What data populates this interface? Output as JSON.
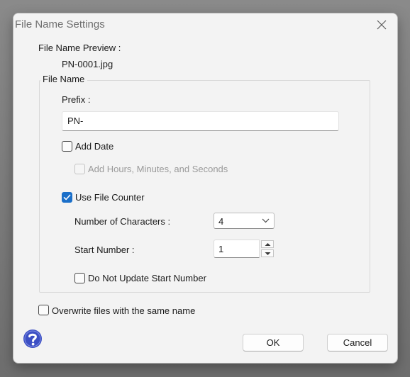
{
  "window": {
    "title": "File Name Settings"
  },
  "preview": {
    "label": "File Name Preview :",
    "value": "PN-0001.jpg"
  },
  "file_name_group": {
    "legend": "File Name",
    "prefix_label": "Prefix :",
    "prefix_value": "PN-",
    "add_date": {
      "label": "Add Date",
      "checked": false
    },
    "add_time": {
      "label": "Add Hours, Minutes, and Seconds",
      "checked": false,
      "enabled": false
    },
    "use_counter": {
      "label": "Use File Counter",
      "checked": true
    },
    "num_chars": {
      "label": "Number of Characters :",
      "value": "4"
    },
    "start_number": {
      "label": "Start Number :",
      "value": "1"
    },
    "do_not_update": {
      "label": "Do Not Update Start Number",
      "checked": false
    }
  },
  "overwrite": {
    "label": "Overwrite files with the same name",
    "checked": false
  },
  "buttons": {
    "ok": "OK",
    "cancel": "Cancel"
  },
  "icons": {
    "close": "close-icon",
    "help": "help-icon",
    "chevron": "chevron-down-icon",
    "spin_up": "arrow-up-icon",
    "spin_down": "arrow-down-icon",
    "checkmark": "checkmark-icon"
  },
  "colors": {
    "accent": "#1a6fc9",
    "help_icon": "#3c4fc4",
    "dialog_bg": "#f3f3f3"
  }
}
